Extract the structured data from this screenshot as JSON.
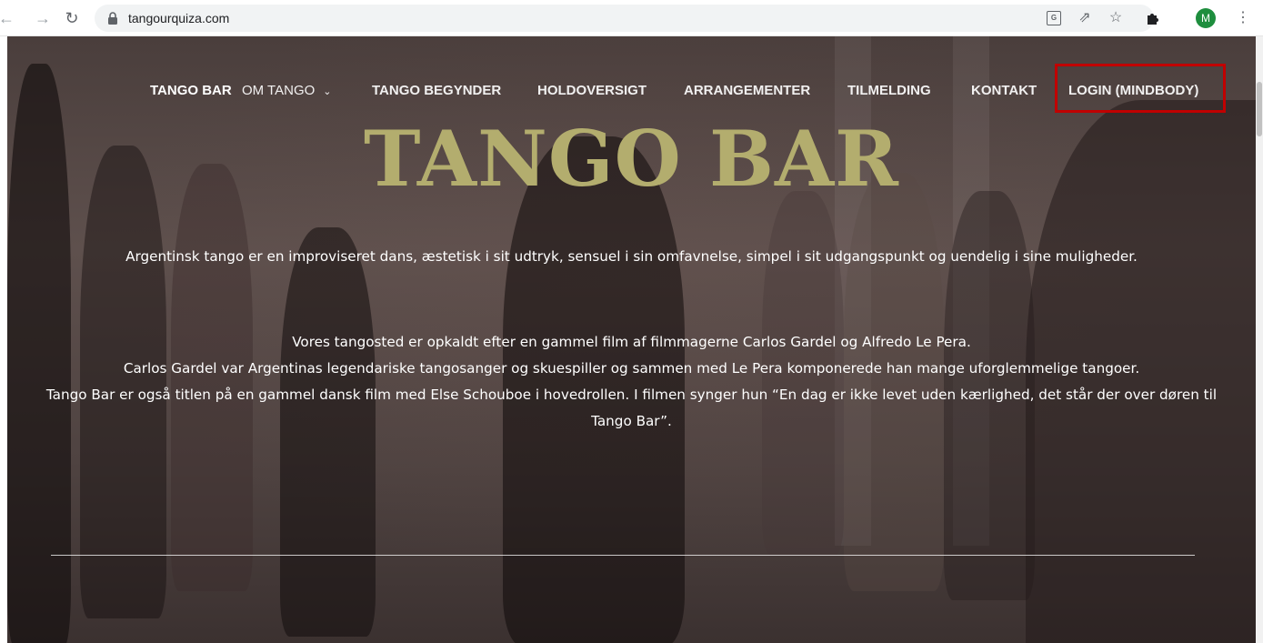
{
  "browser": {
    "url": "tangourquiza.com",
    "avatar_letter": "M",
    "icons": {
      "back": "arrow-left-icon",
      "forward": "arrow-right-icon",
      "reload": "reload-icon",
      "lock": "lock-icon",
      "translate": "translate-icon",
      "share": "share-icon",
      "bookmark": "star-icon",
      "extensions": "puzzle-icon",
      "menu": "kebab-menu-icon"
    }
  },
  "nav": {
    "items": [
      {
        "label": "TANGO BAR"
      },
      {
        "label": "OM TANGO"
      },
      {
        "label": "TANGO BEGYNDER"
      },
      {
        "label": "HOLDOVERSIGT"
      },
      {
        "label": "ARRANGEMENTER"
      },
      {
        "label": "TILMELDING"
      },
      {
        "label": "KONTAKT"
      },
      {
        "label": "LOGIN (MINDBODY)"
      }
    ],
    "highlight_color": "#c00000"
  },
  "hero": {
    "title": "TANGO BAR",
    "title_color": "#b3ad6e",
    "paragraph1": "Argentinsk tango er en improviseret dans, æstetisk i sit udtryk, sensuel i sin omfavnelse, simpel i sit udgangspunkt og uendelig i sine muligheder.",
    "paragraph2_line1": "Vores tangosted er opkaldt efter en gammel film af filmmagerne Carlos Gardel og Alfredo Le Pera.",
    "paragraph2_line2": "Carlos Gardel var Argentinas legendariske tangosanger og skuespiller og sammen med Le Pera komponerede han mange uforglemmelige tangoer.",
    "paragraph2_line3": "Tango Bar er også titlen på en gammel dansk film med Else Schouboe i hovedrollen. I filmen synger hun “En dag er ikke levet uden kærlighed, det står der over døren til Tango Bar”."
  }
}
